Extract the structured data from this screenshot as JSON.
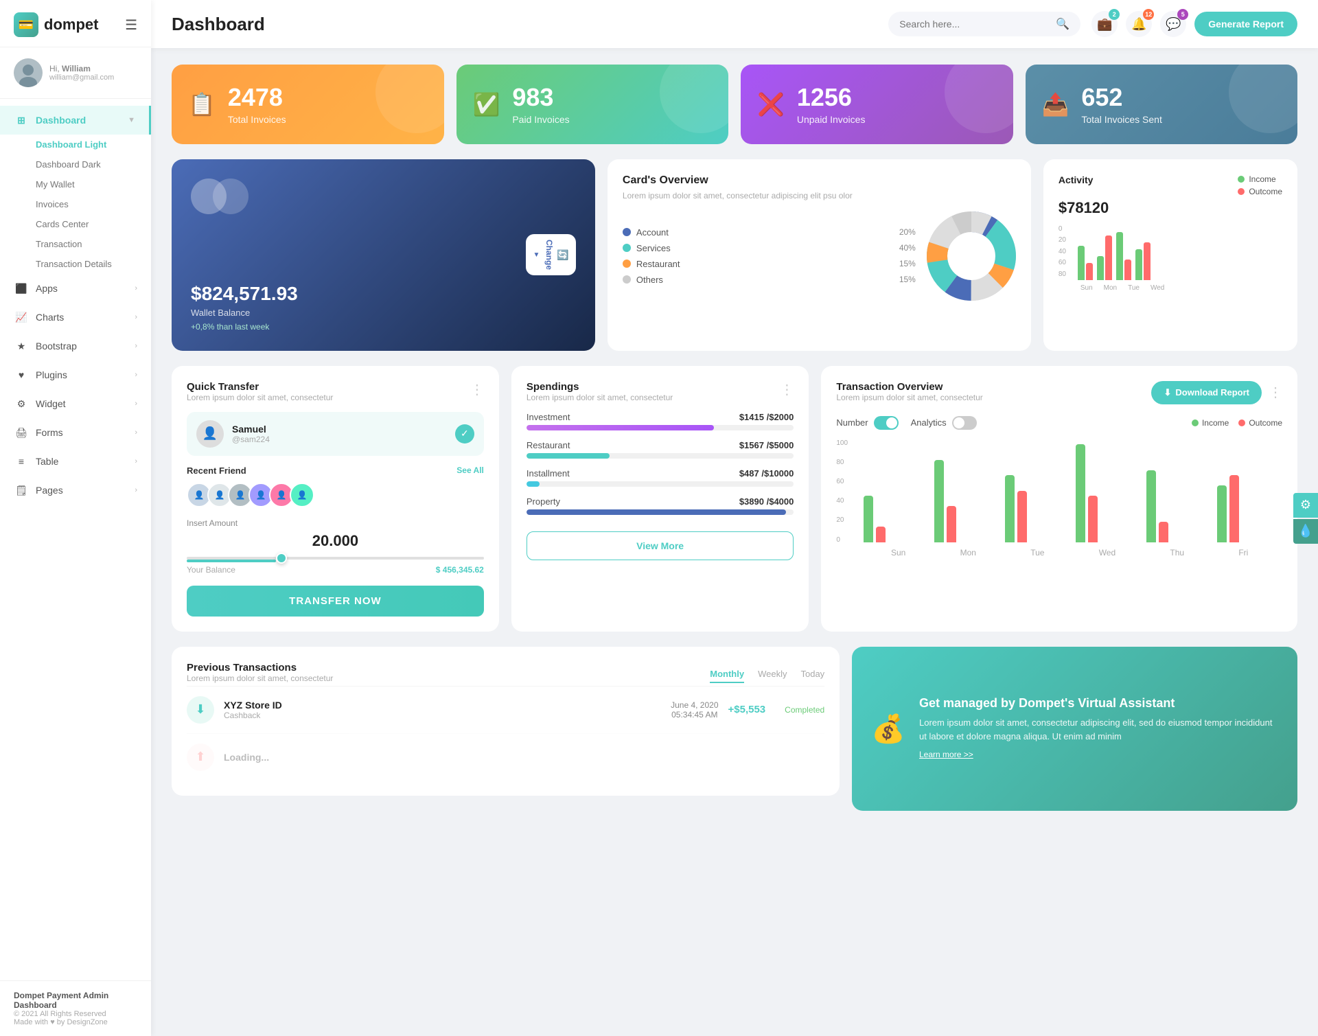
{
  "app": {
    "name": "dompet",
    "title": "Dashboard"
  },
  "header": {
    "search_placeholder": "Search here...",
    "generate_btn": "Generate Report",
    "badges": {
      "wallet": "2",
      "bell": "12",
      "chat": "5"
    }
  },
  "user": {
    "greeting": "Hi,",
    "name": "William",
    "email": "william@gmail.com"
  },
  "sidebar": {
    "nav_items": [
      {
        "label": "Dashboard",
        "icon": "grid",
        "active": true,
        "has_arrow": true
      },
      {
        "label": "Apps",
        "icon": "apps",
        "active": false,
        "has_arrow": true
      },
      {
        "label": "Charts",
        "icon": "chart",
        "active": false,
        "has_arrow": true
      },
      {
        "label": "Bootstrap",
        "icon": "star",
        "active": false,
        "has_arrow": true
      },
      {
        "label": "Plugins",
        "icon": "heart",
        "active": false,
        "has_arrow": true
      },
      {
        "label": "Widget",
        "icon": "gear",
        "active": false,
        "has_arrow": true
      },
      {
        "label": "Forms",
        "icon": "form",
        "active": false,
        "has_arrow": true
      },
      {
        "label": "Table",
        "icon": "table",
        "active": false,
        "has_arrow": true
      },
      {
        "label": "Pages",
        "icon": "pages",
        "active": false,
        "has_arrow": true
      }
    ],
    "sub_items": [
      {
        "label": "Dashboard Light",
        "active": true
      },
      {
        "label": "Dashboard Dark",
        "active": false
      },
      {
        "label": "My Wallet",
        "active": false
      },
      {
        "label": "Invoices",
        "active": false
      },
      {
        "label": "Cards Center",
        "active": false
      },
      {
        "label": "Transaction",
        "active": false
      },
      {
        "label": "Transaction Details",
        "active": false
      }
    ],
    "footer": {
      "brand": "Dompet Payment Admin Dashboard",
      "copyright": "© 2021 All Rights Reserved",
      "made_with": "Made with ♥ by DesignZone"
    }
  },
  "stats": [
    {
      "number": "2478",
      "label": "Total Invoices",
      "color": "orange",
      "icon": "📋"
    },
    {
      "number": "983",
      "label": "Paid Invoices",
      "color": "green",
      "icon": "✅"
    },
    {
      "number": "1256",
      "label": "Unpaid Invoices",
      "color": "purple",
      "icon": "❌"
    },
    {
      "number": "652",
      "label": "Total Invoices Sent",
      "color": "teal",
      "icon": "📤"
    }
  ],
  "wallet": {
    "amount": "$824,571.93",
    "label": "Wallet Balance",
    "change": "+0,8% than last week",
    "btn_label": "Change"
  },
  "cards_overview": {
    "title": "Card's Overview",
    "desc": "Lorem ipsum dolor sit amet, consectetur adipiscing elit psu olor",
    "items": [
      {
        "label": "Account",
        "pct": "20%",
        "color": "#4b6cb7"
      },
      {
        "label": "Services",
        "pct": "40%",
        "color": "#4ecdc4"
      },
      {
        "label": "Restaurant",
        "pct": "15%",
        "color": "#ff9f43"
      },
      {
        "label": "Others",
        "pct": "15%",
        "color": "#ccc"
      }
    ]
  },
  "activity": {
    "title": "Activity",
    "amount": "$78120",
    "legend": [
      {
        "label": "Income",
        "color": "#6bcb77"
      },
      {
        "label": "Outcome",
        "color": "#ff6b6b"
      }
    ],
    "bars": [
      {
        "day": "Sun",
        "income": 50,
        "outcome": 25
      },
      {
        "day": "Mon",
        "income": 35,
        "outcome": 65
      },
      {
        "day": "Tue",
        "income": 70,
        "outcome": 30
      },
      {
        "day": "Wed",
        "income": 45,
        "outcome": 55
      }
    ],
    "y_labels": [
      "0",
      "20",
      "40",
      "60",
      "80"
    ]
  },
  "quick_transfer": {
    "title": "Quick Transfer",
    "desc": "Lorem ipsum dolor sit amet, consectetur",
    "user": {
      "name": "Samuel",
      "handle": "@sam224"
    },
    "recent_friend_label": "Recent Friend",
    "see_all": "See All",
    "insert_amount_label": "Insert Amount",
    "amount": "20.000",
    "balance_label": "Your Balance",
    "balance": "$ 456,345.62",
    "transfer_btn": "TRANSFER NOW"
  },
  "spendings": {
    "title": "Spendings",
    "desc": "Lorem ipsum dolor sit amet, consectetur",
    "items": [
      {
        "label": "Investment",
        "amount": "$1415",
        "max": "$2000",
        "pct": 70,
        "color": "#c471ed"
      },
      {
        "label": "Restaurant",
        "amount": "$1567",
        "max": "$5000",
        "pct": 31,
        "color": "#4ecdc4"
      },
      {
        "label": "Installment",
        "amount": "$487",
        "max": "$10000",
        "pct": 5,
        "color": "#44c9e0"
      },
      {
        "label": "Property",
        "amount": "$3890",
        "max": "$4000",
        "pct": 97,
        "color": "#4b6cb7"
      }
    ],
    "view_more_btn": "View More"
  },
  "transaction_overview": {
    "title": "Transaction Overview",
    "desc": "Lorem ipsum dolor sit amet, consectetur",
    "download_btn": "Download Report",
    "toggle_labels": [
      "Number",
      "Analytics"
    ],
    "legend": [
      "Income",
      "Outcome"
    ],
    "bars": [
      {
        "day": "Sun",
        "income": 45,
        "outcome": 15
      },
      {
        "day": "Mon",
        "income": 80,
        "outcome": 35
      },
      {
        "day": "Tue",
        "income": 65,
        "outcome": 50
      },
      {
        "day": "Wed",
        "income": 95,
        "outcome": 45
      },
      {
        "day": "Thu",
        "income": 70,
        "outcome": 20
      },
      {
        "day": "Fri",
        "income": 55,
        "outcome": 65
      }
    ],
    "y_labels": [
      "0",
      "20",
      "40",
      "60",
      "80",
      "100"
    ]
  },
  "prev_transactions": {
    "title": "Previous Transactions",
    "desc": "Lorem ipsum dolor sit amet, consectetur",
    "tabs": [
      "Monthly",
      "Weekly",
      "Today"
    ],
    "active_tab": "Monthly",
    "items": [
      {
        "name": "XYZ Store ID",
        "type": "Cashback",
        "date": "June 4, 2020",
        "time": "05:34:45 AM",
        "amount": "+$5,553",
        "status": "Completed",
        "icon": "⬇"
      }
    ]
  },
  "virtual_assistant": {
    "title": "Get managed by Dompet's Virtual Assistant",
    "desc": "Lorem ipsum dolor sit amet, consectetur adipiscing elit, sed do eiusmod tempor incididunt ut labore et dolore magna aliqua. Ut enim ad minim",
    "link": "Learn more >>"
  }
}
